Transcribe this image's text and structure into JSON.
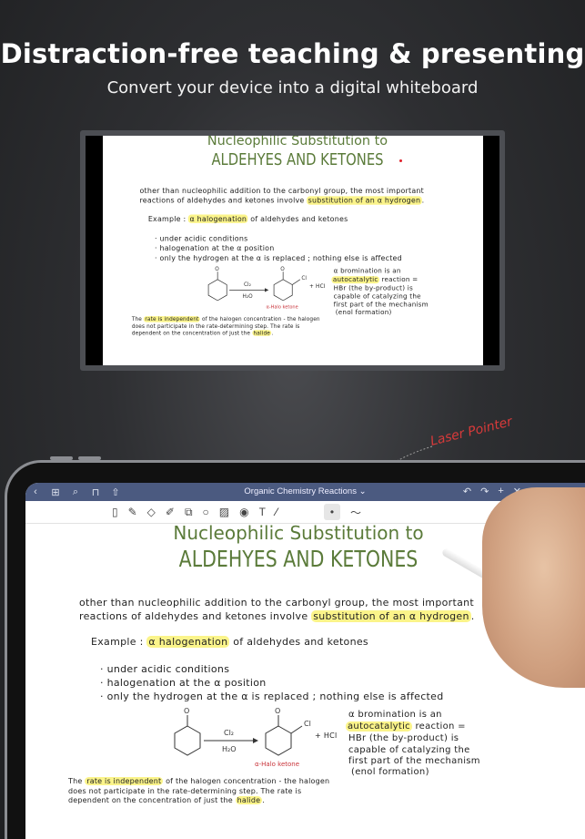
{
  "headline": "Distraction-free teaching & presenting",
  "subheadline": "Convert your device into a digital whiteboard",
  "laser_label": "Laser Pointer",
  "navbar": {
    "title": "Organic Chemistry Reactions",
    "chevron": "⌄"
  },
  "note": {
    "title1": "Nucleophilic Substitution to",
    "title2": "ALDEHYES AND KETONES",
    "para1": "other than nucleophilic addition to the carbonyl group, the most important",
    "para2a": "reactions of aldehydes and ketones involve ",
    "para2b": "substitution of an α hydrogen",
    "example_a": "Example : ",
    "example_b": "α halogenation",
    "example_c": " of aldehydes and ketones",
    "bullets": [
      "· under acidic conditions",
      "· halogenation at the α position",
      "· only the hydrogen at the α is replaced ; nothing else is affected"
    ],
    "reagent_top": "Cl₂",
    "reagent_bottom": "H₂O",
    "oxygen": "O",
    "chlorine": "Cl",
    "plus_hcl": "+ HCl",
    "product_label": "α-Halo ketone",
    "side1": "α bromination is an",
    "side2a": "autocatalytic",
    "side2b": " reaction =",
    "side3": "HBr (the by-product) is",
    "side4": "capable of catalyzing the",
    "side5": "first part of the mechanism",
    "side6": "(enol formation)",
    "foot1a": "The ",
    "foot1b": "rate is independent",
    "foot1c": " of the halogen concentration - the halogen",
    "foot2": "does not participate in the rate-determining step. The rate is",
    "foot3a": "dependent on the concentration of just the ",
    "foot3b": "halide",
    "foot3c": "."
  },
  "colors": {
    "accent": "#4b5a80",
    "title_green": "#5b7b3a",
    "highlight": "#fbf48a",
    "laser": "#e0202a"
  }
}
